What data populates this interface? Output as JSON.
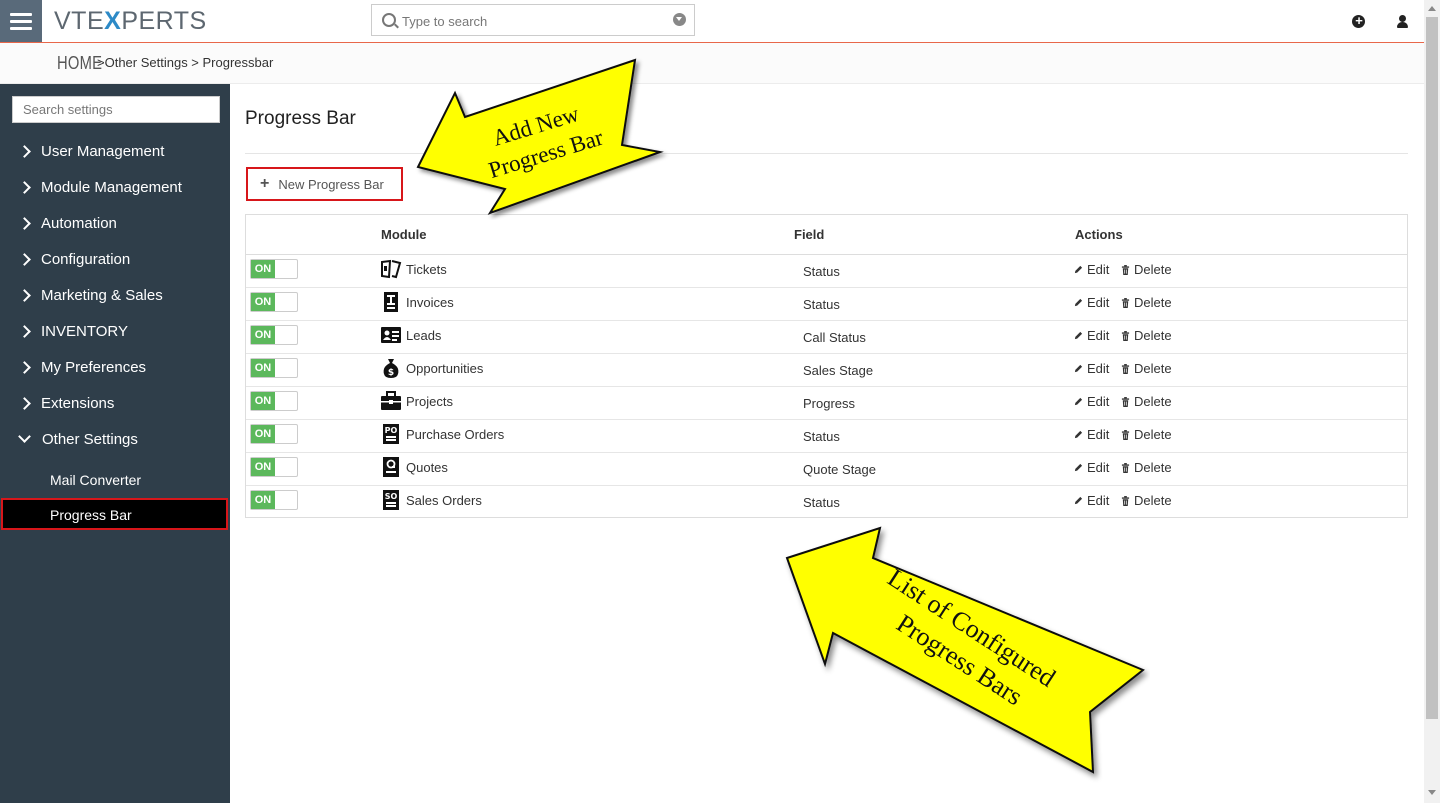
{
  "header": {
    "logo_prefix": "VTE",
    "logo_x": "X",
    "logo_suffix": "PERTS",
    "search_placeholder": "Type to search"
  },
  "breadcrumb": {
    "home": "HOME",
    "path": ">Other Settings >  Progressbar"
  },
  "sidebar": {
    "search_placeholder": "Search settings",
    "items": [
      {
        "label": "User Management"
      },
      {
        "label": "Module Management"
      },
      {
        "label": "Automation"
      },
      {
        "label": "Configuration"
      },
      {
        "label": "Marketing & Sales"
      },
      {
        "label": "INVENTORY"
      },
      {
        "label": "My Preferences"
      },
      {
        "label": "Extensions"
      },
      {
        "label": "Other Settings"
      }
    ],
    "sub_items": [
      {
        "label": "Mail Converter"
      },
      {
        "label": "Progress Bar"
      }
    ]
  },
  "main": {
    "title": "Progress Bar",
    "new_button_label": "New Progress Bar",
    "columns": {
      "module": "Module",
      "field": "Field",
      "actions": "Actions"
    },
    "edit_label": "Edit",
    "delete_label": "Delete",
    "toggle_label": "ON",
    "rows": [
      {
        "module": "Tickets",
        "field": "Status",
        "icon": "ticket-icon"
      },
      {
        "module": "Invoices",
        "field": "Status",
        "icon": "invoice-icon"
      },
      {
        "module": "Leads",
        "field": "Call Status",
        "icon": "lead-card-icon"
      },
      {
        "module": "Opportunities",
        "field": "Sales Stage",
        "icon": "money-bag-icon"
      },
      {
        "module": "Projects",
        "field": "Progress",
        "icon": "briefcase-icon"
      },
      {
        "module": "Purchase Orders",
        "field": "Status",
        "icon": "po-icon"
      },
      {
        "module": "Quotes",
        "field": "Quote Stage",
        "icon": "quote-icon"
      },
      {
        "module": "Sales Orders",
        "field": "Status",
        "icon": "so-icon"
      }
    ]
  },
  "callouts": {
    "add_new_line1": "Add New",
    "add_new_line2": "Progress Bar",
    "list_line1": "List of Configured",
    "list_line2": "Progress Bars"
  },
  "colors": {
    "accent": "#e8674a",
    "sidebar": "#2f3e4a",
    "toggle_on": "#5cb85c",
    "highlight": "#d7161a",
    "callout": "#ffff00"
  }
}
